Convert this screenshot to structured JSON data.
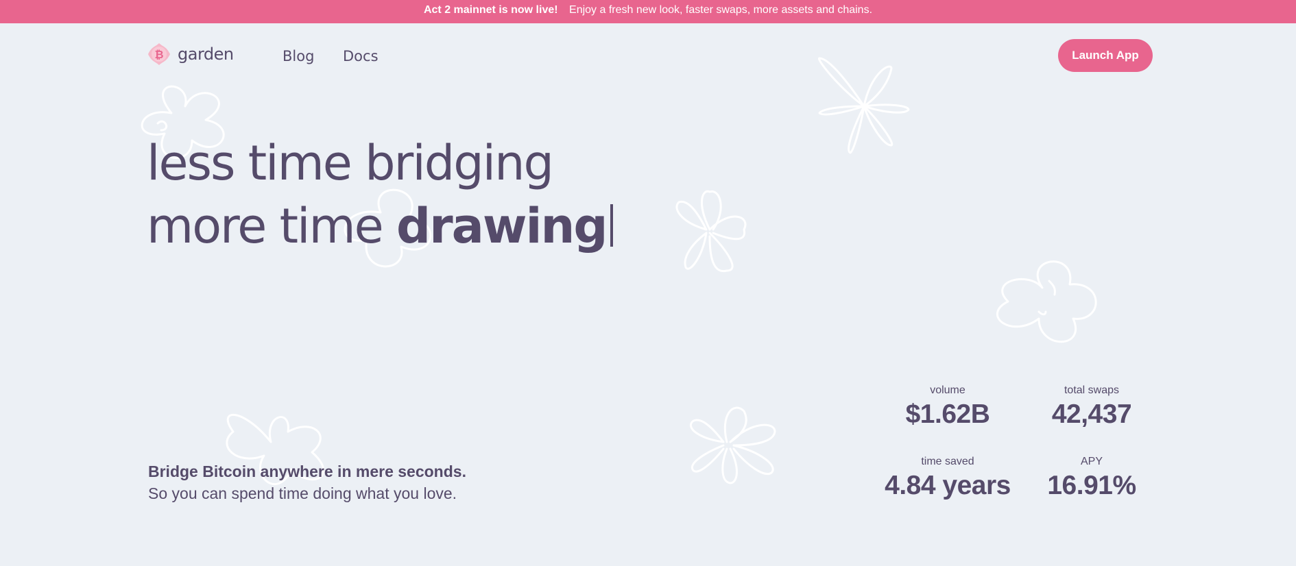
{
  "announcement": {
    "highlight": "Act 2 mainnet is now live!",
    "text": "Enjoy a fresh new look, faster swaps, more assets and chains."
  },
  "header": {
    "logo_text": "garden",
    "logo_icon": "bitcoin-icon",
    "nav": [
      {
        "label": "Blog"
      },
      {
        "label": "Docs"
      }
    ],
    "cta_label": "Launch App"
  },
  "hero": {
    "line1": "less time bridging",
    "line2_prefix": "more time ",
    "line2_bold": "drawing"
  },
  "tagline": {
    "bold": "Bridge Bitcoin anywhere in mere seconds.",
    "normal": "So you can spend time doing what you love."
  },
  "stats": [
    {
      "label": "volume",
      "value": "$1.62B"
    },
    {
      "label": "total swaps",
      "value": "42,437"
    },
    {
      "label": "time saved",
      "value": "4.84 years"
    },
    {
      "label": "APY",
      "value": "16.91%"
    }
  ],
  "colors": {
    "accent": "#E8658E",
    "text": "#554B6A",
    "background": "#ECF0F5"
  }
}
